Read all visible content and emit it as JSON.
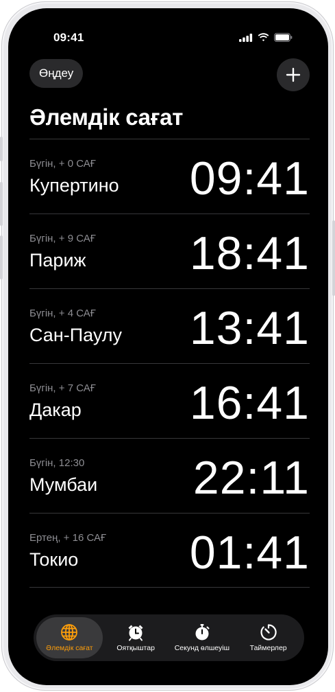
{
  "status_bar": {
    "time": "09:41"
  },
  "header": {
    "edit_label": "Өңдеу",
    "add_icon": "plus-icon",
    "title": "Әлемдік сағат"
  },
  "clocks": [
    {
      "offset": "Бүгін, + 0 САҒ",
      "city": "Купертино",
      "time": "09:41"
    },
    {
      "offset": "Бүгін, + 9 САҒ",
      "city": "Париж",
      "time": "18:41"
    },
    {
      "offset": "Бүгін, + 4 САҒ",
      "city": "Сан-Паулу",
      "time": "13:41"
    },
    {
      "offset": "Бүгін, + 7 САҒ",
      "city": "Дакар",
      "time": "16:41"
    },
    {
      "offset": "Бүгін, 12:30",
      "city": "Мумбаи",
      "time": "22:11"
    },
    {
      "offset": "Ертең, + 16 САҒ",
      "city": "Токио",
      "time": "01:41"
    }
  ],
  "tabs": [
    {
      "label": "Әлемдік сағат",
      "icon": "globe-icon",
      "active": true
    },
    {
      "label": "Оятқыштар",
      "icon": "alarm-clock-icon",
      "active": false
    },
    {
      "label": "Секунд өлшеуіш",
      "icon": "stopwatch-icon",
      "active": false
    },
    {
      "label": "Таймерлер",
      "icon": "timer-icon",
      "active": false
    }
  ],
  "colors": {
    "accent": "#ff9f0a",
    "background": "#000000",
    "secondary_text": "#8e8e93",
    "separator": "#38383a"
  }
}
